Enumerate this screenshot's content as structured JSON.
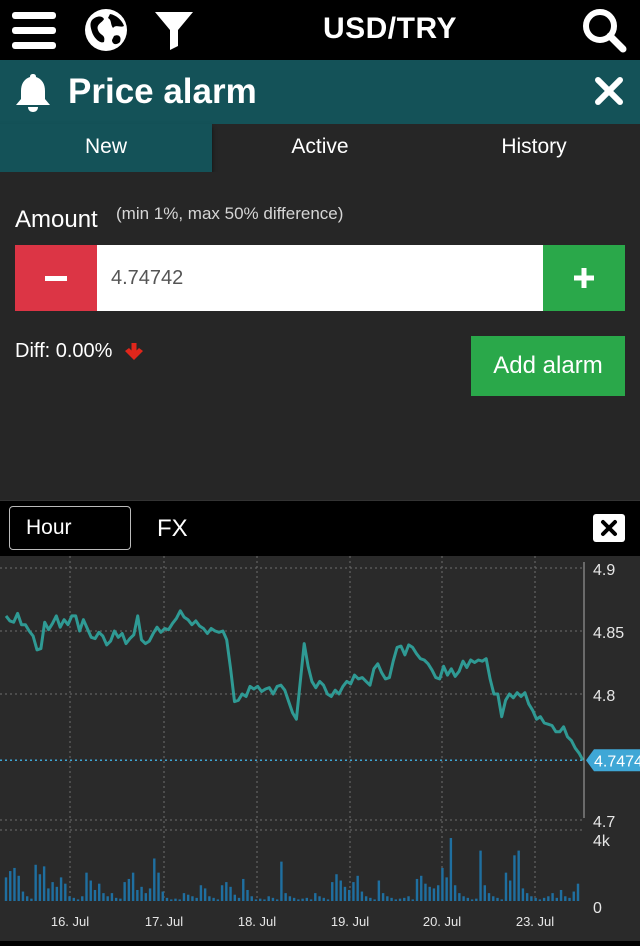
{
  "topbar": {
    "menu_icon": "hamburger-menu-icon",
    "globe_icon": "globe-icon",
    "filter_icon": "filter-icon",
    "title": "USD/TRY",
    "search_icon": "search-icon"
  },
  "alarm": {
    "title": "Price alarm",
    "bell_icon": "bell-icon",
    "close_icon": "close-icon"
  },
  "tabs": [
    {
      "label": "New",
      "active": true
    },
    {
      "label": "Active",
      "active": false
    },
    {
      "label": "History",
      "active": false
    }
  ],
  "form": {
    "amount_label": "Amount",
    "amount_hint": "(min 1%, max 50% difference)",
    "amount_value": "4.74742",
    "minus_icon": "minus-icon",
    "plus_icon": "plus-icon",
    "diff_text": "Diff: 0.00%",
    "diff_icon": "arrow-down-icon",
    "add_button": "Add alarm"
  },
  "chart_header": {
    "interval": "Hour",
    "instrument": "FX"
  },
  "colors": {
    "accent": "#145258",
    "line": "#2f9a94",
    "volume": "#1f6fa0",
    "minus": "#dc3545",
    "plus": "#2aa84a",
    "price_tag": "#3fa7d6"
  },
  "chart_data": {
    "type": "line",
    "y_ticks": [
      "4.9",
      "4.85",
      "4.8",
      "4.7"
    ],
    "ylim": [
      4.7,
      4.9
    ],
    "x_ticks": [
      "16. Jul",
      "17. Jul",
      "18. Jul",
      "19. Jul",
      "20. Jul",
      "23. Jul"
    ],
    "current_price": "4.7474",
    "current_price_value": 4.7474,
    "volume_ticks": [
      "4k",
      "0"
    ],
    "volume_max": 4000,
    "grid": true,
    "series": [
      {
        "values": [
          4.862,
          4.858,
          4.857,
          4.864,
          4.855,
          4.855,
          4.85,
          4.846,
          4.835,
          4.836,
          4.857,
          4.851,
          4.856,
          4.862,
          4.853,
          4.859,
          4.855,
          4.862,
          4.862,
          4.85,
          4.859,
          4.852,
          4.845,
          4.844,
          4.849,
          4.846,
          4.839,
          4.842,
          4.85,
          4.845,
          4.848,
          4.84,
          4.844,
          4.847,
          4.862,
          4.843,
          4.84,
          4.842,
          4.848,
          4.853,
          4.849,
          4.852,
          4.851,
          4.856,
          4.86,
          4.866,
          4.861,
          4.859,
          4.855,
          4.858,
          4.854,
          4.852,
          4.848,
          4.852,
          4.85,
          4.849,
          4.85,
          4.843,
          4.82,
          4.794,
          4.795,
          4.8,
          4.798,
          4.806,
          4.804,
          4.806,
          4.802,
          4.804,
          4.805,
          4.8,
          4.806,
          4.807,
          4.803,
          4.794,
          4.785,
          4.78,
          4.81,
          4.84,
          4.822,
          4.81,
          4.805,
          4.81,
          4.807,
          4.8,
          4.798,
          4.803,
          4.8,
          4.806,
          4.81,
          4.808,
          4.815,
          4.812,
          4.813,
          4.81,
          4.807,
          4.82,
          4.824,
          4.817,
          4.812,
          4.813,
          4.826,
          4.837,
          4.838,
          4.831,
          4.839,
          4.837,
          4.832,
          4.828,
          4.827,
          4.824,
          4.819,
          4.813,
          4.812,
          4.822,
          4.815,
          4.82,
          4.814,
          4.818,
          4.826,
          4.821,
          4.827,
          4.825,
          4.827,
          4.826,
          4.828,
          4.812,
          4.8,
          4.8,
          4.782,
          4.795,
          4.8,
          4.797,
          4.801,
          4.798,
          4.801,
          4.792,
          4.787,
          4.78,
          4.782,
          4.777,
          4.776,
          4.775,
          4.77,
          4.77,
          4.774,
          4.766,
          4.763,
          4.757,
          4.753,
          4.7474
        ],
        "volumes": [
          1500,
          1900,
          2100,
          1600,
          600,
          300,
          150,
          2300,
          1700,
          2200,
          800,
          1200,
          900,
          1500,
          1100,
          300,
          200,
          100,
          300,
          1800,
          1300,
          700,
          1100,
          500,
          300,
          500,
          200,
          150,
          1200,
          1400,
          1800,
          700,
          900,
          500,
          800,
          2700,
          1800,
          600,
          200,
          100,
          150,
          100,
          500,
          400,
          300,
          200,
          1000,
          800,
          300,
          200,
          100,
          1000,
          1200,
          900,
          400,
          200,
          1400,
          700,
          300,
          100,
          150,
          100,
          300,
          200,
          100,
          2500,
          500,
          300,
          200,
          100,
          150,
          200,
          100,
          500,
          300,
          200,
          100,
          1200,
          1700,
          1300,
          900,
          700,
          1200,
          1600,
          600,
          300,
          200,
          100,
          1300,
          500,
          300,
          200,
          100,
          150,
          200,
          300,
          100,
          1400,
          1600,
          1100,
          900,
          800,
          1000,
          2100,
          1500,
          4000,
          1000,
          500,
          300,
          200,
          100,
          150,
          3200,
          1000,
          500,
          300,
          200,
          100,
          1800,
          1300,
          2900,
          3200,
          800,
          500,
          300,
          200,
          100,
          200,
          300,
          500,
          200,
          700,
          300,
          200,
          600,
          1100
        ]
      }
    ]
  }
}
